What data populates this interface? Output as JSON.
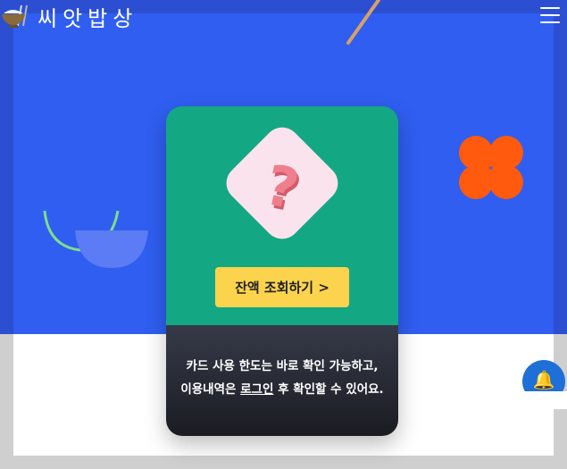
{
  "header": {
    "brand_name": "씨앗밥상",
    "logo_icon": "rice-bowl-chopsticks-icon",
    "menu_icon": "hamburger-menu-icon"
  },
  "card": {
    "illustration_icon": "question-mark-icon",
    "balance_button_label": "잔액 조회하기 >",
    "info_line1": "카드 사용 한도는 바로 확인 가능하고,",
    "info_line2_prefix": "이용내역은 ",
    "info_line2_link": "로그인",
    "info_line2_suffix": " 후 확인할 수 있어요."
  },
  "floating": {
    "notification_icon": "bell-icon"
  },
  "colors": {
    "hero_blue": "#2f5ef0",
    "card_green": "#14a783",
    "button_yellow": "#fcd34d",
    "accent_orange": "#ff5a0d"
  }
}
